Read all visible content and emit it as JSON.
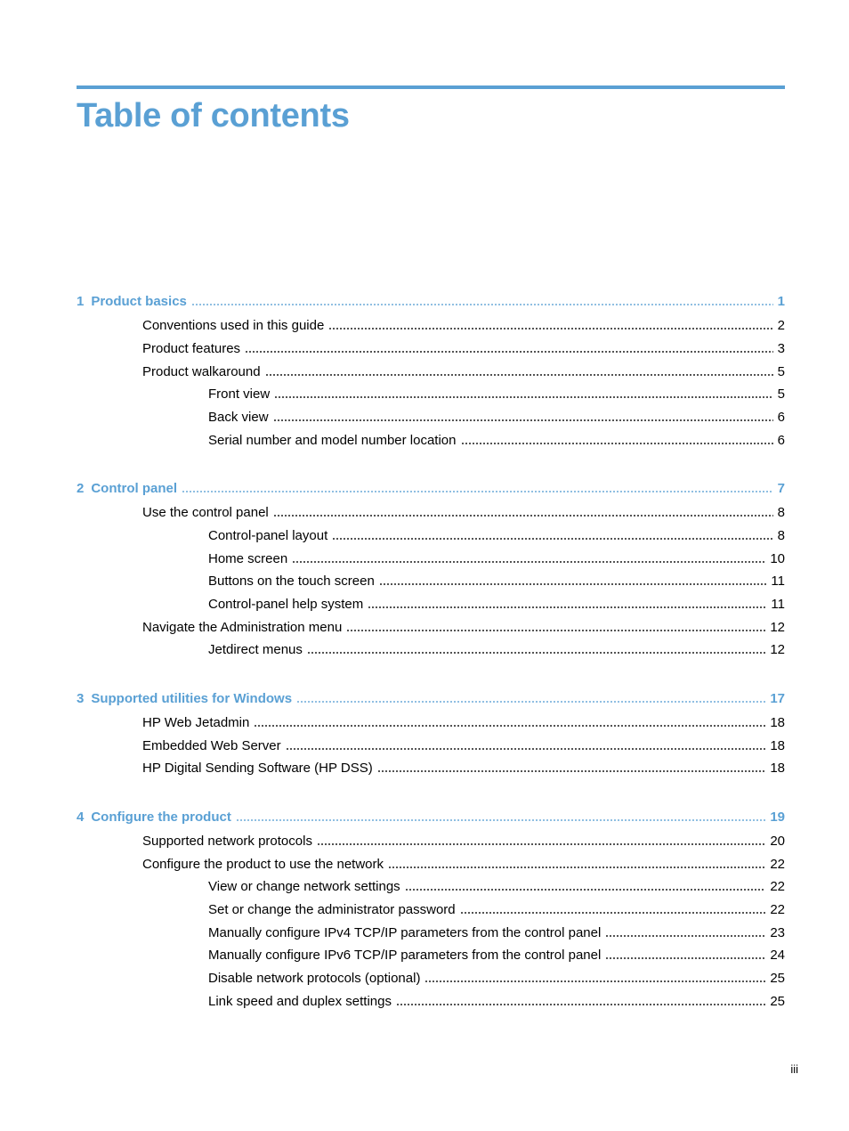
{
  "page": {
    "title": "Table of contents",
    "accent_color": "#5aa0d4",
    "footer_page_number": "iii"
  },
  "toc": [
    {
      "number": "1",
      "title": "Product basics",
      "page": "1",
      "entries": [
        {
          "level": 2,
          "title": "Conventions used in this guide",
          "page": "2"
        },
        {
          "level": 2,
          "title": "Product features",
          "page": "3"
        },
        {
          "level": 2,
          "title": "Product walkaround",
          "page": "5"
        },
        {
          "level": 3,
          "title": "Front view",
          "page": "5"
        },
        {
          "level": 3,
          "title": "Back view",
          "page": "6"
        },
        {
          "level": 3,
          "title": "Serial number and model number location",
          "page": "6"
        }
      ]
    },
    {
      "number": "2",
      "title": "Control panel",
      "page": "7",
      "entries": [
        {
          "level": 2,
          "title": "Use the control panel",
          "page": "8"
        },
        {
          "level": 3,
          "title": "Control-panel layout",
          "page": "8"
        },
        {
          "level": 3,
          "title": "Home screen",
          "page": "10"
        },
        {
          "level": 3,
          "title": "Buttons on the touch screen",
          "page": "11"
        },
        {
          "level": 3,
          "title": "Control-panel help system",
          "page": "11"
        },
        {
          "level": 2,
          "title": "Navigate the Administration menu",
          "page": "12"
        },
        {
          "level": 3,
          "title": "Jetdirect menus",
          "page": "12"
        }
      ]
    },
    {
      "number": "3",
      "title": "Supported utilities for Windows",
      "page": "17",
      "entries": [
        {
          "level": 2,
          "title": "HP Web Jetadmin",
          "page": "18"
        },
        {
          "level": 2,
          "title": "Embedded Web Server",
          "page": "18"
        },
        {
          "level": 2,
          "title": "HP Digital Sending Software (HP DSS)",
          "page": "18"
        }
      ]
    },
    {
      "number": "4",
      "title": "Configure the product",
      "page": "19",
      "entries": [
        {
          "level": 2,
          "title": "Supported network protocols",
          "page": "20"
        },
        {
          "level": 2,
          "title": "Configure the product to use the network",
          "page": "22"
        },
        {
          "level": 3,
          "title": "View or change network settings",
          "page": "22"
        },
        {
          "level": 3,
          "title": "Set or change the administrator password",
          "page": "22"
        },
        {
          "level": 3,
          "title": "Manually configure IPv4 TCP/IP parameters from the control panel",
          "page": "23"
        },
        {
          "level": 3,
          "title": "Manually configure IPv6 TCP/IP parameters from the control panel",
          "page": "24"
        },
        {
          "level": 3,
          "title": "Disable network protocols (optional)",
          "page": "25"
        },
        {
          "level": 3,
          "title": "Link speed and duplex settings",
          "page": "25"
        }
      ]
    }
  ]
}
